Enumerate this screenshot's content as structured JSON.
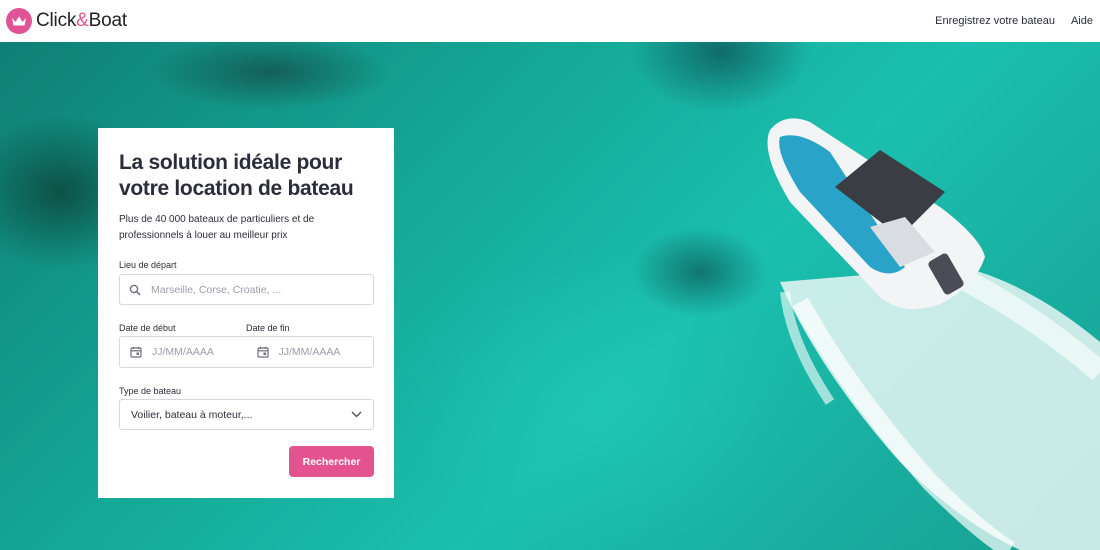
{
  "header": {
    "logo_text_1": "Click",
    "logo_amp": "&",
    "logo_text_2": "Boat",
    "logo_icon": "crown-icon",
    "nav": {
      "register": "Enregistrez votre bateau",
      "help": "Aide"
    }
  },
  "hero": {
    "image": "speedboat-on-turquoise-sea"
  },
  "search_card": {
    "title": "La solution idéale pour votre location de bateau",
    "subtitle": "Plus de 40 000 bateaux de particuliers et de professionnels à louer au meilleur prix",
    "departure": {
      "label": "Lieu de départ",
      "placeholder": "Marseille, Corse, Croatie, ...",
      "icon": "search-icon"
    },
    "start_date": {
      "label": "Date de début",
      "placeholder": "JJ/MM/AAAA",
      "icon": "calendar-icon"
    },
    "end_date": {
      "label": "Date de fin",
      "placeholder": "JJ/MM/AAAA",
      "icon": "calendar-icon"
    },
    "boat_type": {
      "label": "Type de bateau",
      "value": "Voilier, bateau à moteur,...",
      "icon": "chevron-down-icon"
    },
    "submit_label": "Rechercher"
  },
  "colors": {
    "brand_pink": "#e4528f",
    "text_dark": "#2c2c3a",
    "sea": "#17b3a3"
  }
}
